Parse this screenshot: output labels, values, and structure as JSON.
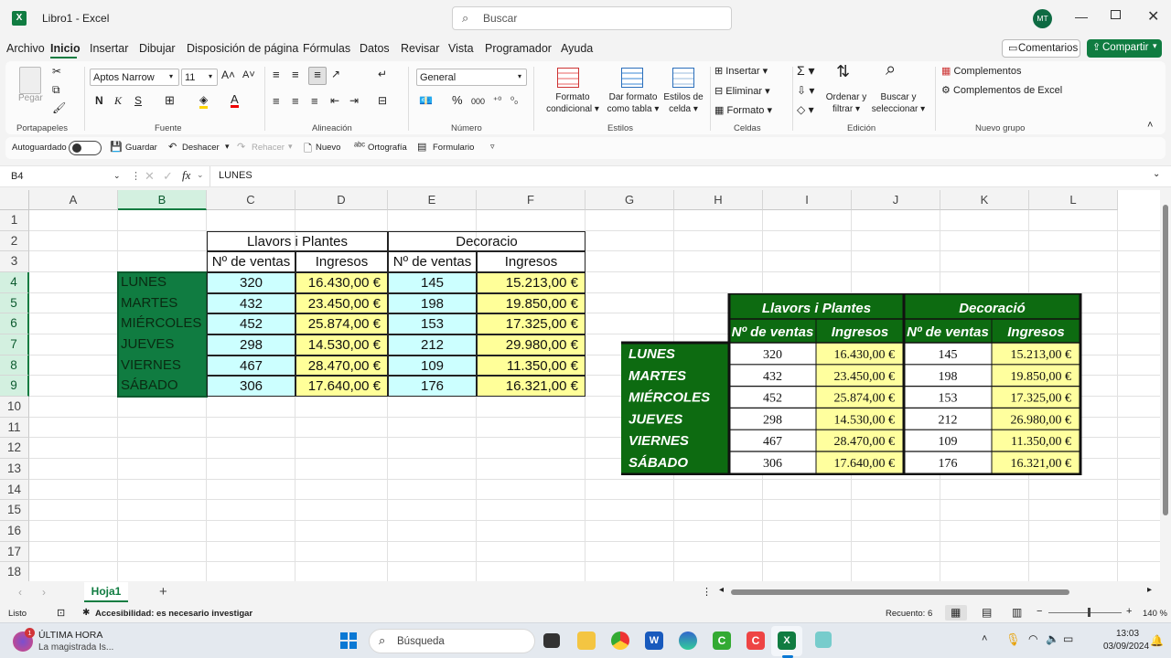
{
  "titlebar": {
    "file_title": "Libro1 - Excel",
    "search_placeholder": "Buscar",
    "user_initials": "MT"
  },
  "menu": {
    "items": [
      "Archivo",
      "Inicio",
      "Insertar",
      "Dibujar",
      "Disposición de página",
      "Fórmulas",
      "Datos",
      "Revisar",
      "Vista",
      "Programador",
      "Ayuda"
    ],
    "comments": "Comentarios",
    "share": "Compartir"
  },
  "ribbon": {
    "paste": "Pegar",
    "clipboard": "Portapapeles",
    "font_name": "Aptos Narrow",
    "font_size": "11",
    "font_group": "Fuente",
    "align_group": "Alineación",
    "number_format": "General",
    "number_group": "Número",
    "cond_format_1": "Formato",
    "cond_format_2": "condicional",
    "table_format_1": "Dar formato",
    "table_format_2": "como tabla",
    "cell_styles_1": "Estilos de",
    "cell_styles_2": "celda",
    "styles_group": "Estilos",
    "insert": "Insertar",
    "delete": "Eliminar",
    "format": "Formato",
    "cells_group": "Celdas",
    "sort_1": "Ordenar y",
    "sort_2": "filtrar",
    "find_1": "Buscar y",
    "find_2": "seleccionar",
    "edit_group": "Edición",
    "addins": "Complementos",
    "excel_addins": "Complementos de Excel",
    "new_group": "Nuevo grupo"
  },
  "qat": {
    "autosave": "Autoguardado",
    "save": "Guardar",
    "undo": "Deshacer",
    "redo": "Rehacer",
    "new": "Nuevo",
    "spelling": "Ortografía",
    "form": "Formulario"
  },
  "formula_bar": {
    "name_box": "B4",
    "formula": "LUNES"
  },
  "columns": [
    "A",
    "B",
    "C",
    "D",
    "E",
    "F",
    "G",
    "H",
    "I",
    "J",
    "K",
    "L"
  ],
  "rows": [
    "1",
    "2",
    "3",
    "4",
    "5",
    "6",
    "7",
    "8",
    "9",
    "10",
    "11",
    "12",
    "13",
    "14",
    "15",
    "16",
    "17",
    "18"
  ],
  "sheet": {
    "group1": "Llavors i Plantes",
    "group2": "Decoracio",
    "h_sales": "Nº de ventas",
    "h_income": "Ingresos",
    "days": [
      "LUNES",
      "MARTES",
      "MIÉRCOLES",
      "JUEVES",
      "VIERNES",
      "SÁBADO"
    ],
    "sales1": [
      "320",
      "432",
      "452",
      "298",
      "467",
      "306"
    ],
    "income1": [
      "16.430,00 €",
      "23.450,00 €",
      "25.874,00 €",
      "14.530,00 €",
      "28.470,00 €",
      "17.640,00 €"
    ],
    "sales2": [
      "145",
      "198",
      "153",
      "212",
      "109",
      "176"
    ],
    "income2": [
      "15.213,00 €",
      "19.850,00 €",
      "17.325,00 €",
      "29.980,00 €",
      "11.350,00 €",
      "16.321,00 €"
    ]
  },
  "picture": {
    "group1": "Llavors i Plantes",
    "group2": "Decoració",
    "h_sales": "Nº de ventas",
    "h_income": "Ingresos",
    "days": [
      "LUNES",
      "MARTES",
      "MIÉRCOLES",
      "JUEVES",
      "VIERNES",
      "SÁBADO"
    ],
    "sales1": [
      "320",
      "432",
      "452",
      "298",
      "467",
      "306"
    ],
    "income1": [
      "16.430,00 €",
      "23.450,00 €",
      "25.874,00 €",
      "14.530,00 €",
      "28.470,00 €",
      "17.640,00 €"
    ],
    "sales2": [
      "145",
      "198",
      "153",
      "212",
      "109",
      "176"
    ],
    "income2": [
      "15.213,00 €",
      "19.850,00 €",
      "17.325,00 €",
      "26.980,00 €",
      "11.350,00 €",
      "16.321,00 €"
    ]
  },
  "tabs": {
    "sheet1": "Hoja1",
    "add": "+"
  },
  "status": {
    "ready": "Listo",
    "accessibility": "Accesibilidad: es necesario investigar",
    "count": "Recuento: 6",
    "zoom": "140 %"
  },
  "taskbar": {
    "news_title": "ÚLTIMA HORA",
    "news_sub": "La magistrada Is...",
    "search": "Búsqueda",
    "time": "13:03",
    "date": "03/09/2024",
    "badge": "1"
  },
  "colors": {
    "green": "#107c41",
    "dark_green": "#0d6b11",
    "cyan": "#ccffff",
    "yellow": "#ffff99",
    "pic_yellow": "#ffff9e"
  }
}
